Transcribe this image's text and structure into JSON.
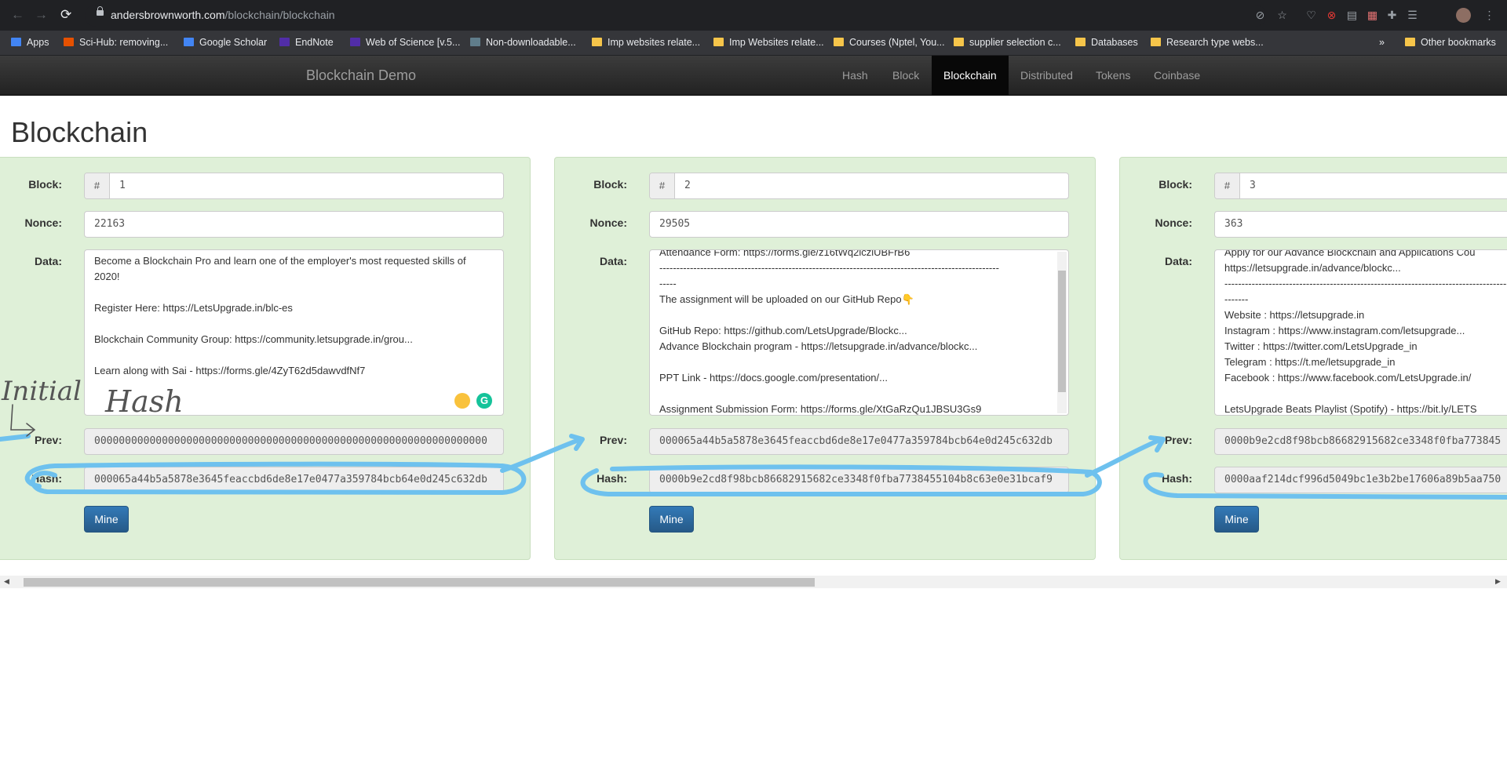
{
  "browser": {
    "url_domain": "andersbrownworth.com",
    "url_path": "/blockchain/blockchain",
    "bookmarks": [
      "Apps",
      "Sci-Hub: removing...",
      "Google Scholar",
      "EndNote",
      "Web of Science [v.5...",
      "Non-downloadable...",
      "Imp websites relate...",
      "Imp Websites relate...",
      "Courses (Nptel, You...",
      "supplier selection c...",
      "Databases",
      "Research type webs..."
    ],
    "more_bookmarks": "»",
    "other_bookmarks": "Other bookmarks"
  },
  "navbar": {
    "brand": "Blockchain Demo",
    "items": [
      "Hash",
      "Block",
      "Blockchain",
      "Distributed",
      "Tokens",
      "Coinbase"
    ],
    "active": "Blockchain"
  },
  "page_title": "Blockchain",
  "labels": {
    "block": "Block:",
    "nonce": "Nonce:",
    "data": "Data:",
    "prev": "Prev:",
    "hash": "Hash:",
    "mine": "Mine",
    "hash_prefix": "#"
  },
  "blocks": [
    {
      "number": "1",
      "nonce": "22163",
      "data_lines": [
        "Become a Blockchain Pro and learn one of the employer's most requested skills of",
        "2020!",
        "",
        "Register Here: https://LetsUpgrade.in/blc-es",
        "",
        "Blockchain Community Group: https://community.letsupgrade.in/grou...",
        "",
        "Learn along with Sai - https://forms.gle/4ZyT62d5dawvdfNf7"
      ],
      "prev": "0000000000000000000000000000000000000000000000000000000000000000",
      "hash": "000065a44b5a5878e3645feaccbd6de8e17e0477a359784bcb64e0d245c632db"
    },
    {
      "number": "2",
      "nonce": "29505",
      "data_lines": [
        "Attendance Form: https://forms.gle/z16tWq2iczlUBFrB6",
        "----------------------------------------------------------------------------------------------------",
        "-----",
        "The assignment will be uploaded on our GitHub Repo👇",
        "",
        "GitHub Repo: https://github.com/LetsUpgrade/Blockc...",
        "Advance Blockchain program - https://letsupgrade.in/advance/blockc...",
        "",
        "PPT Link - https://docs.google.com/presentation/...",
        "",
        "Assignment Submission Form: https://forms.gle/XtGaRzQu1JBSU3Gs9"
      ],
      "prev": "000065a44b5a5878e3645feaccbd6de8e17e0477a359784bcb64e0d245c632db",
      "hash": "0000b9e2cd8f98bcb86682915682ce3348f0fba7738455104b8c63e0e31bcaf9"
    },
    {
      "number": "3",
      "nonce": "363",
      "data_lines": [
        "Apply for our Advance Blockchain and Applications Cou",
        "https://letsupgrade.in/advance/blockc...",
        "----------------------------------------------------------------------------------------------------",
        "-------",
        "Website : https://letsupgrade.in",
        "Instagram : https://www.instagram.com/letsupgrade...",
        "Twitter : https://twitter.com/LetsUpgrade_in",
        "Telegram : https://t.me/letsupgrade_in",
        "Facebook : https://www.facebook.com/LetsUpgrade.in/",
        "",
        "LetsUpgrade Beats Playlist (Spotify) - https://bit.ly/LETS"
      ],
      "prev": "0000b9e2cd8f98bcb86682915682ce3348f0fba773845",
      "hash": "0000aaf214dcf996d5049bc1e3b2be17606a89b5aa750"
    }
  ],
  "annotation": {
    "initial": "Initial",
    "hash": "Hash"
  }
}
